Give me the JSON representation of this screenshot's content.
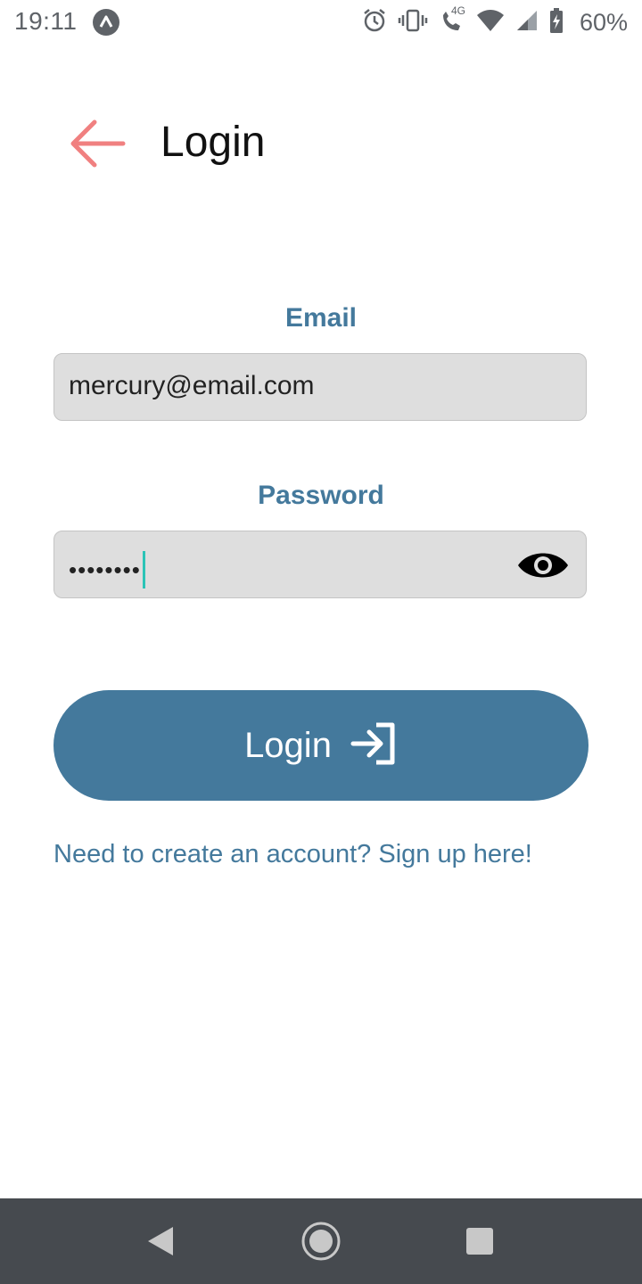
{
  "status_bar": {
    "time": "19:11",
    "battery_text": "60%",
    "network_label": "4G",
    "icons": [
      "app-notification-icon",
      "alarm-icon",
      "vibrate-icon",
      "wifi-calling-icon",
      "wifi-icon",
      "signal-icon",
      "battery-charging-icon"
    ]
  },
  "header": {
    "title": "Login",
    "back_icon": "arrow-left-icon",
    "back_color": "#f08080"
  },
  "form": {
    "email_label": "Email",
    "email_value": "mercury@email.com",
    "password_label": "Password",
    "password_value": "••••••••",
    "password_toggle_icon": "eye-icon"
  },
  "login_button": {
    "label": "Login",
    "icon": "login-arrow-icon"
  },
  "signup_link": "Need to create an account? Sign up here!",
  "colors": {
    "accent": "#44799c",
    "input_background": "#dedede",
    "caret": "#2bc4b7",
    "nav_bar": "#464a4f"
  },
  "nav_bar": {
    "buttons": [
      "back-triangle-icon",
      "home-circle-icon",
      "recents-square-icon"
    ]
  }
}
